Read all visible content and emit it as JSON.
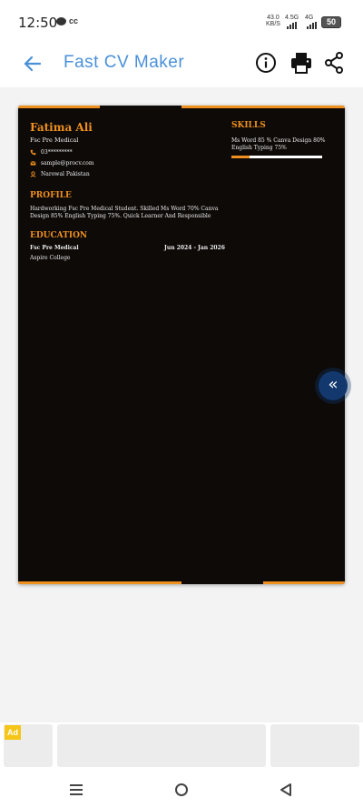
{
  "status_bar": {
    "time": "12:50",
    "cc_label": "cc",
    "speed_value": "43.0",
    "speed_unit": "KB/S",
    "network1": "4.5G",
    "network2": "4G",
    "battery": "50"
  },
  "app_bar": {
    "title": "Fast CV Maker",
    "icons": [
      "back-arrow-icon",
      "info-icon",
      "printer-icon",
      "share-icon"
    ]
  },
  "cv": {
    "name": "Fatima Ali",
    "subtitle": "Fsc Pre Medical",
    "phone": "03*********",
    "email": "sample@procv.com",
    "location": "Narowal Pakistan",
    "profile_title": "PROFILE",
    "profile_text": "Hardworking Fsc Pre Medical Student. Skilled Ms Word 70% Canva Design 85% English Typing 75%. Quick Learner And Responsible",
    "education_title": "EDUCATION",
    "education": {
      "degree": "Fsc Pre Medical",
      "dates": "Jun 2024 - Jan 2026",
      "school": "Aspire College"
    },
    "skills_title": "SKILLS",
    "skills_line1": "Ms Word 85 % Canva Design 80%",
    "skills_line2": "English Typing 75%",
    "skill_bar_fraction": 0.2
  },
  "fab": {
    "icon": "double-chevron-left-icon",
    "glyph": "«"
  },
  "ad": {
    "badge": "Ad"
  },
  "colors": {
    "accent": "#f0901e",
    "title_blue": "#4a90d9",
    "cv_background": "#0d0a08",
    "fab": "#12386e"
  }
}
